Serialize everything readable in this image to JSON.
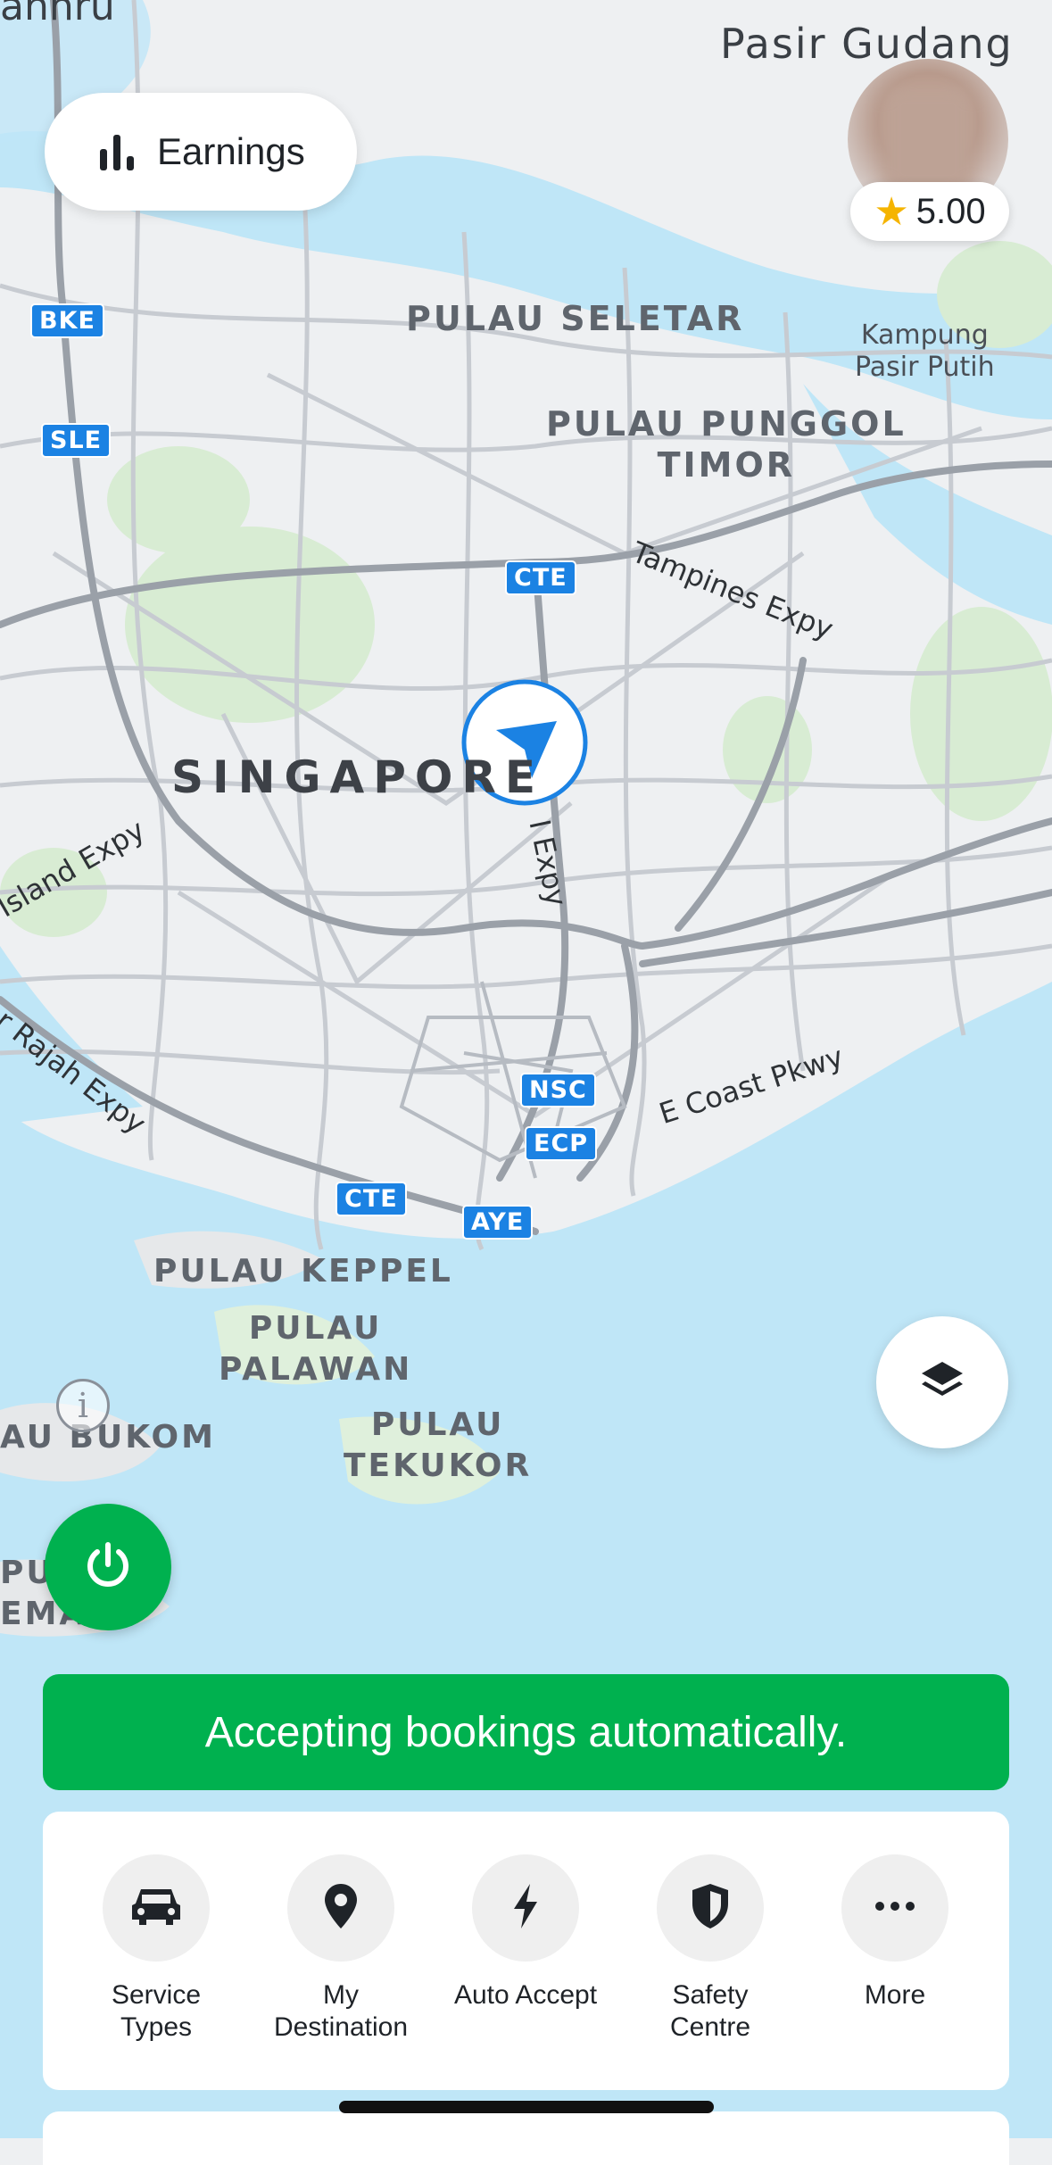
{
  "map": {
    "labels": {
      "pasir_gudang": "Pasir Gudang",
      "anhru": "anhru",
      "pulau_seletar": "PULAU SELETAR",
      "kampung_pasir_putih": "Kampung\nPasir Putih",
      "pulau_punggol_timor": "PULAU PUNGGOL\nTIMOR",
      "tampines_expy": "Tampines Expy",
      "singapore": "SINGAPORE",
      "island_expy": "Island Expy",
      "rajah_expy": "r Rajah Expy",
      "i_expy": "I Expy",
      "e_coast_pkwy": "E Coast Pkwy",
      "pulau_keppel": "PULAU KEPPEL",
      "pulau_palawan": "PULAU\nPALAWAN",
      "pulau_bukom": "AU BUKOM",
      "pulau_tekukor": "PULAU\nTEKUKOR",
      "pulau_semakau": "PU\nEMA U"
    },
    "shields": {
      "bke": "BKE",
      "sle": "SLE",
      "cte_north": "CTE",
      "nsc": "NSC",
      "ecp": "ECP",
      "cte_south": "CTE",
      "aye": "AYE"
    }
  },
  "header": {
    "earnings_label": "Earnings",
    "rating": "5.00"
  },
  "status": {
    "banner_text": "Accepting bookings automatically."
  },
  "quick_actions": [
    {
      "label": "Service\nTypes",
      "icon": "car-icon"
    },
    {
      "label": "My\nDestination",
      "icon": "location-pin-icon"
    },
    {
      "label": "Auto Accept",
      "icon": "lightning-icon"
    },
    {
      "label": "Safety\nCentre",
      "icon": "shield-icon"
    },
    {
      "label": "More",
      "icon": "more-dots-icon"
    }
  ],
  "colors": {
    "accent_green": "#00b14f",
    "location_blue": "#1b82e3",
    "water": "#bfe6f7",
    "land": "#eef0f2"
  }
}
